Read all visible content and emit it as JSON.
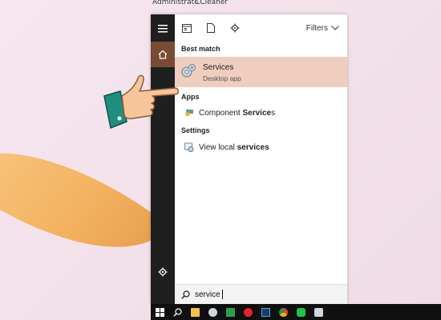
{
  "desktop": {
    "label_1": "Administrato...",
    "label_2": "CCleaner"
  },
  "menu": {
    "filters_label": "Filters",
    "sections": {
      "best_match": "Best match",
      "apps": "Apps",
      "settings": "Settings"
    },
    "best_match_item": {
      "title": "Services",
      "subtitle": "Desktop app"
    },
    "apps": [
      {
        "prefix": "Component ",
        "bold": "Service",
        "suffix": "s"
      }
    ],
    "settings": [
      {
        "prefix": "View local ",
        "bold": "services",
        "suffix": ""
      }
    ],
    "search": {
      "value": "service"
    }
  },
  "colors": {
    "accent": "#7a4a34",
    "highlight": "#efcdbf",
    "rail": "#1f1f1f",
    "taskbar": "#101010"
  },
  "taskbar_icons": [
    "windows-start-icon",
    "search-icon",
    "file-explorer-icon",
    "camera-icon",
    "app-green-icon",
    "opera-icon",
    "photoshop-icon",
    "chrome-icon",
    "line-icon",
    "printer-icon"
  ]
}
